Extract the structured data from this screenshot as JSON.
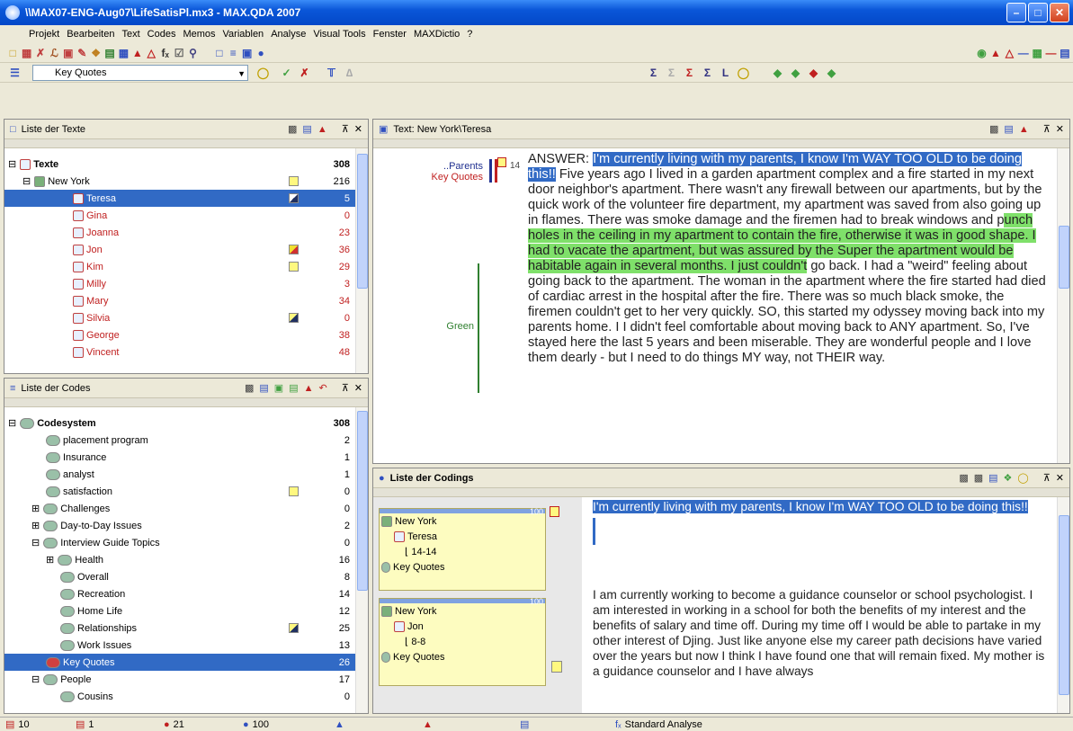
{
  "window": {
    "title": "\\\\MAX07-ENG-Aug07\\LifeSatisPl.mx3 - MAX.QDA 2007"
  },
  "menu": [
    "Projekt",
    "Bearbeiten",
    "Text",
    "Codes",
    "Memos",
    "Variablen",
    "Analyse",
    "Visual Tools",
    "Fenster",
    "MAXDictio",
    "?"
  ],
  "toolbar": {
    "active_code": "Key Quotes"
  },
  "texts_pane": {
    "title": "Liste der Texte",
    "rows": [
      {
        "label": "Texte",
        "count": "308"
      },
      {
        "label": "New York",
        "count": "216"
      },
      {
        "label": "Teresa",
        "count": "5"
      },
      {
        "label": "Gina",
        "count": "0"
      },
      {
        "label": "Joanna",
        "count": "23"
      },
      {
        "label": "Jon",
        "count": "36"
      },
      {
        "label": "Kim",
        "count": "29"
      },
      {
        "label": "Milly",
        "count": "3"
      },
      {
        "label": "Mary",
        "count": "34"
      },
      {
        "label": "Silvia",
        "count": "0"
      },
      {
        "label": "George",
        "count": "38"
      },
      {
        "label": "Vincent",
        "count": "48"
      }
    ]
  },
  "codes_pane": {
    "title": "Liste der Codes",
    "rows": [
      {
        "label": "Codesystem",
        "count": "308"
      },
      {
        "label": "placement program",
        "count": "2"
      },
      {
        "label": "Insurance",
        "count": "1"
      },
      {
        "label": "analyst",
        "count": "1"
      },
      {
        "label": "satisfaction",
        "count": "0"
      },
      {
        "label": "Challenges",
        "count": "0"
      },
      {
        "label": "Day-to-Day Issues",
        "count": "2"
      },
      {
        "label": "Interview Guide Topics",
        "count": "0"
      },
      {
        "label": "Health",
        "count": "16"
      },
      {
        "label": "Overall",
        "count": "8"
      },
      {
        "label": "Recreation",
        "count": "14"
      },
      {
        "label": "Home Life",
        "count": "12"
      },
      {
        "label": "Relationships",
        "count": "25"
      },
      {
        "label": "Work Issues",
        "count": "13"
      },
      {
        "label": "Key Quotes",
        "count": "26"
      },
      {
        "label": "People",
        "count": "17"
      },
      {
        "label": "Cousins",
        "count": "0"
      }
    ]
  },
  "text_pane": {
    "title": "Text: New York\\Teresa",
    "margin_codes": {
      "parents": "..Parents",
      "keyquotes": "Key Quotes",
      "green": "Green"
    },
    "para_num": "14",
    "answer_label": "ANSWER:",
    "seg_sel": "I'm currently living with my parents, I know I'm WAY TOO OLD to be doing this!!",
    "seg_a": " Five years ago I lived in a garden apartment complex and a fire started in my next door neighbor's apartment.  There wasn't any firewall between our apartments, but by the quick work of the volunteer fire department, my apartment was saved from also going up in flames.  There was smoke damage and the firemen had to break windows and p",
    "seg_green": "unch holes in the ceiling in my apartment to contain the fire, otherwise it was in good shape.  I had to vacate the apartment, but was assured by the Super the apartment would be habitable again in several months.  I just couldn't",
    "seg_b": " go back.  I had a \"weird\" feeling about going back to the apartment.  The woman in the apartment where the fire started had died of cardiac arrest in the hospital after the fire.  There was so much black smoke, the firemen couldn't get to her very quickly.  SO, this started my odyssey moving back into my parents home.  I I didn't feel comfortable about moving back to ANY apartment.  So, I've stayed here the last 5 years and been miserable.  They are wonderful people and I love them dearly - but I need to do things MY way, not THEIR way."
  },
  "codings_pane": {
    "title": "Liste der Codings",
    "boxes": [
      {
        "weight": "100",
        "group": "New York",
        "doc": "Teresa",
        "range": "14-14",
        "code": "Key Quotes"
      },
      {
        "weight": "100",
        "group": "New York",
        "doc": "Jon",
        "range": "8-8",
        "code": "Key Quotes"
      }
    ],
    "seg1": "I'm currently living with my parents, I know I'm WAY TOO OLD to be doing this!!",
    "seg2": "I am currently working to become a guidance counselor or school psychologist.  I am interested in working in a school for both the benefits of my interest and the benefits of salary and time off.  During my time off I would be able to partake in my other interest of Djing.   Just like anyone else my career path decisions have varied over the years but now I think I have found one that will remain fixed.  My mother is a guidance counselor and I have always"
  },
  "statusbar": [
    {
      "label": "10"
    },
    {
      "label": "1"
    },
    {
      "label": "21"
    },
    {
      "label": "100"
    },
    {
      "label": "Standard Analyse"
    }
  ],
  "colors": {
    "selection": "#316ac5",
    "green_highlight": "#7fe06a",
    "title_blue": "#0a56d8",
    "memo_yellow": "#fdfcc0"
  }
}
